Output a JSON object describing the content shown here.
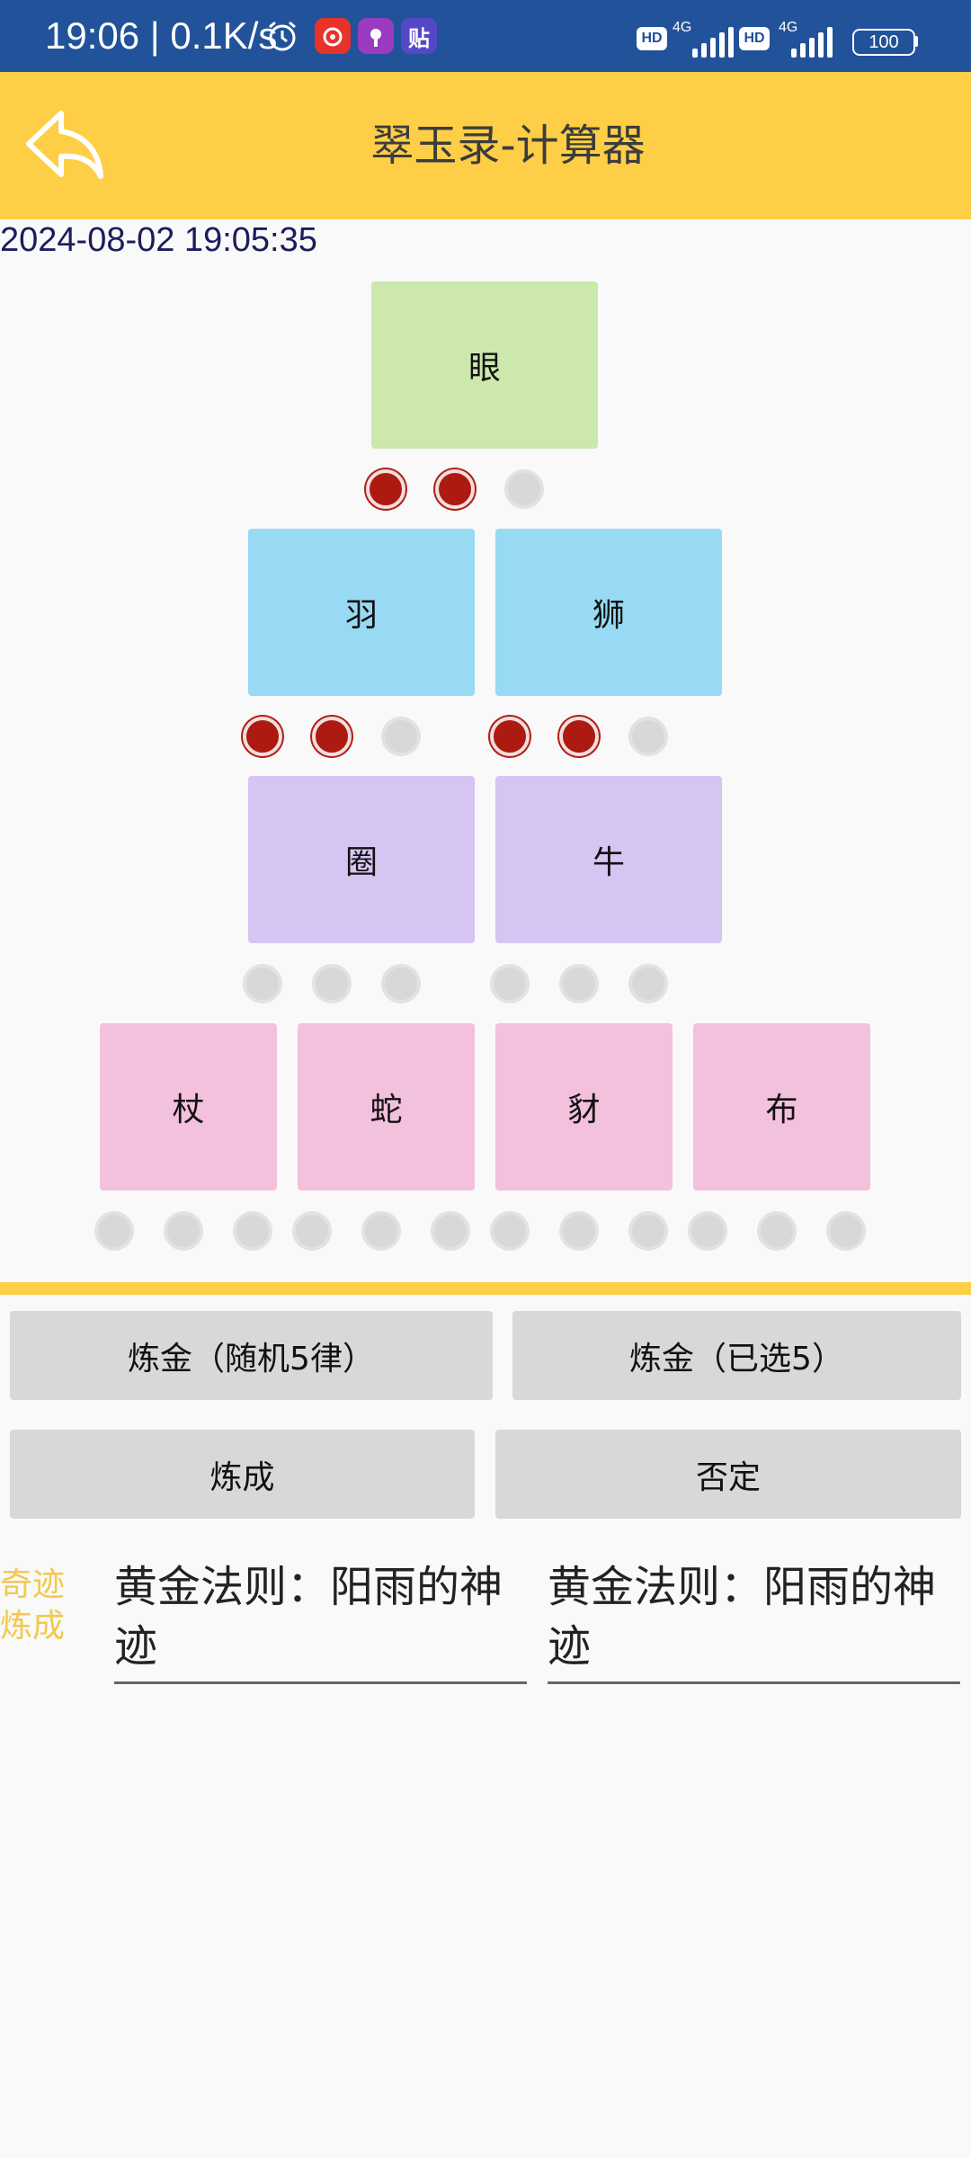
{
  "status_bar": {
    "time": "19:06 | 0.1K/s",
    "icons": [
      "alarm-icon",
      "netease-music-icon",
      "podcast-icon",
      "tieba-icon"
    ],
    "hd_label": "HD",
    "network_label": "4G",
    "battery": "100"
  },
  "app_bar": {
    "title": "翠玉录-计算器"
  },
  "timestamp": "2024-08-02 19:05:35",
  "blocks": {
    "eye": "眼",
    "feather": "羽",
    "lion": "狮",
    "ring": "圈",
    "ox": "牛",
    "staff": "杖",
    "snake": "蛇",
    "leopard": "豺",
    "cloth": "布"
  },
  "dot_rows": {
    "row1": [
      true,
      true,
      false
    ],
    "row2_left": [
      true,
      true,
      false
    ],
    "row2_right": [
      true,
      true,
      false
    ],
    "row3_left": [
      false,
      false,
      false
    ],
    "row3_right": [
      false,
      false,
      false
    ],
    "row4": [
      false,
      false,
      false,
      false,
      false,
      false,
      false,
      false,
      false,
      false,
      false,
      false
    ]
  },
  "buttons": {
    "alchemy_random": "炼金（随机5律）",
    "alchemy_selected": "炼金（已选5）",
    "complete": "炼成",
    "deny": "否定"
  },
  "miracle": {
    "label": "奇迹炼成",
    "result_left": "黄金法则：阳雨的神迹",
    "result_right": "黄金法则：阳雨的神迹"
  },
  "colors": {
    "status_bar": "#21529a",
    "app_bar": "#fecf46",
    "eye_block": "#cce8ad",
    "tier2_block": "#98daf4",
    "tier3_block": "#d6c4f3",
    "tier4_block": "#f3c0de",
    "dot_active": "#ac1a12",
    "dot_inactive": "#d8d8d8",
    "miracle_label": "#f4c84a"
  }
}
